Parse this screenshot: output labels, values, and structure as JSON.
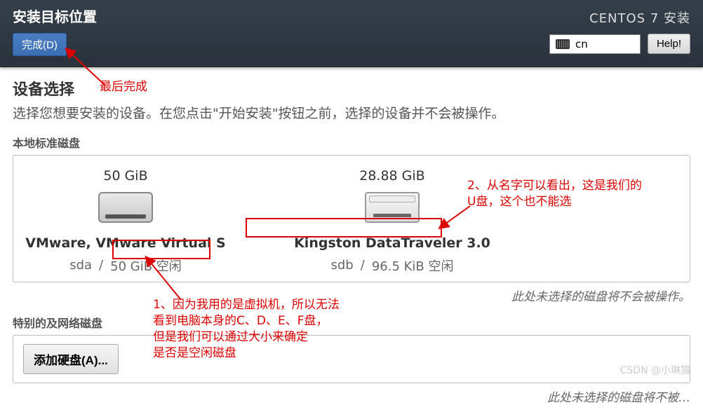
{
  "header": {
    "title": "安装目标位置",
    "done_label": "完成(D)",
    "installer_title": "CENTOS 7 安装",
    "lang_code": "cn",
    "help_label": "Help!"
  },
  "device": {
    "section_title": "设备选择",
    "section_desc": "选择您想要安装的设备。在您点击\"开始安装\"按钮之前，选择的设备并不会被操作。",
    "local_disks_heading": "本地标准磁盘",
    "disks": [
      {
        "size": "50 GiB",
        "name": "VMware, VMware Virtual S",
        "dev": "sda",
        "sep": "/",
        "free": "50 GiB 空闲"
      },
      {
        "size": "28.88 GiB",
        "name": "Kingston DataTraveler 3.0",
        "dev": "sdb",
        "sep": "/",
        "free": "96.5 KiB 空闲"
      }
    ],
    "not_selected_note": "此处未选择的磁盘将不会被操作。",
    "network_disks_heading": "特别的及网络磁盘",
    "add_disk_label": "添加硬盘(A)...",
    "not_selected_note2": "此处未选择的磁盘将不被…"
  },
  "annotations": {
    "a0": "最后完成",
    "a1_l1": "1、因为我用的是虚拟机，所以无法",
    "a1_l2": "看到电脑本身的C、D、E、F盘，",
    "a1_l3": "但是我们可以通过大小来确定",
    "a1_l4": "是否是空闲磁盘",
    "a2_l1": "2、从名字可以看出，这是我们的",
    "a2_l2": "U盘，这个也不能选"
  },
  "watermark": "CSDN @小琳猫"
}
